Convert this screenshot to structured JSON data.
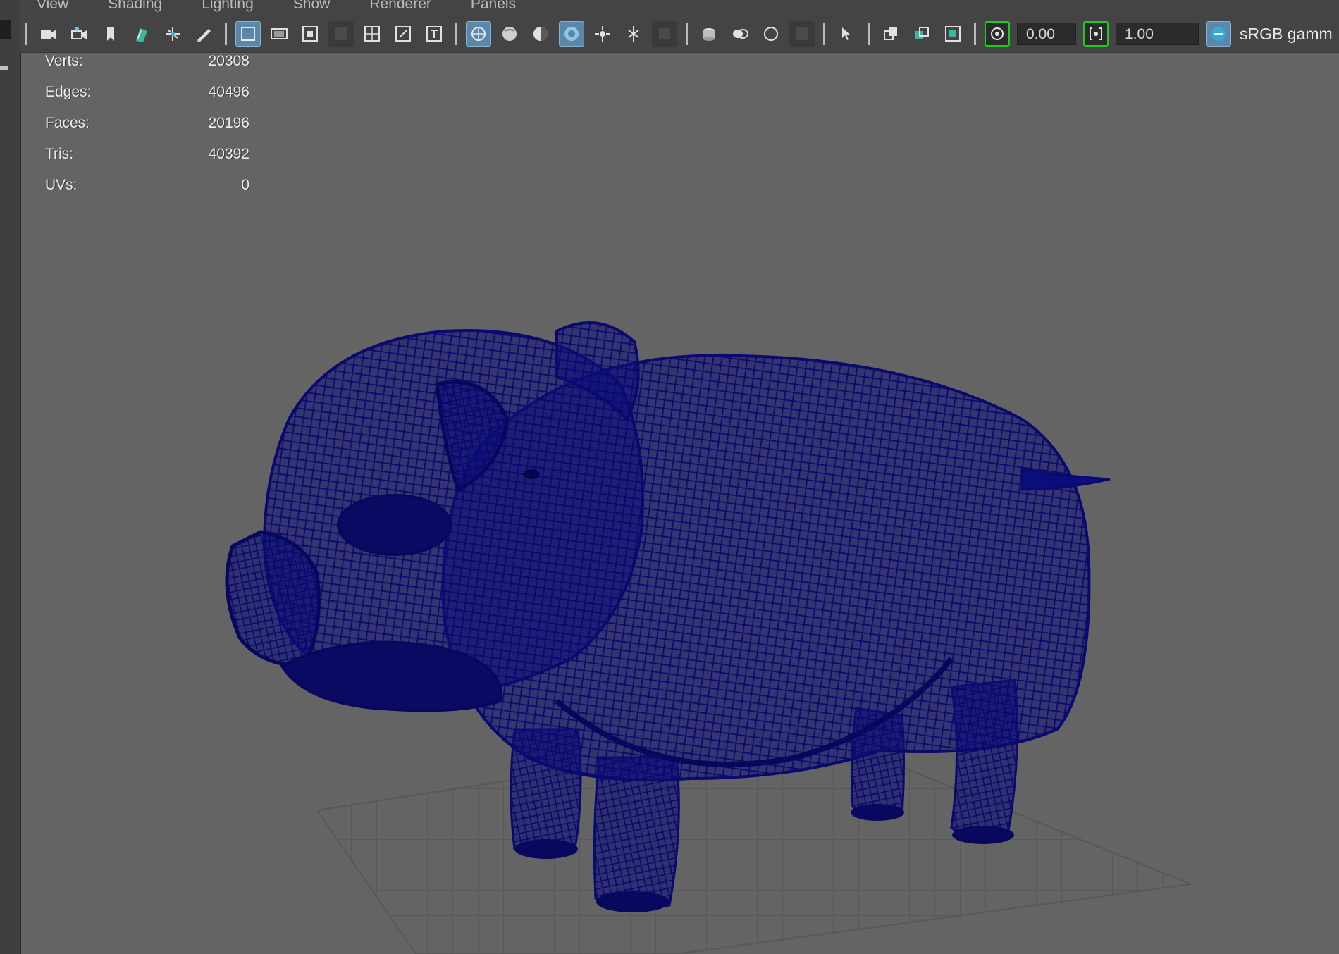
{
  "menu": {
    "items": [
      {
        "label": "View"
      },
      {
        "label": "Shading"
      },
      {
        "label": "Lighting"
      },
      {
        "label": "Show"
      },
      {
        "label": "Renderer"
      },
      {
        "label": "Panels"
      }
    ]
  },
  "toolbar": {
    "icons": [
      "camera-icon",
      "camera-attributes-icon",
      "bookmark-icon",
      "image-plane-icon",
      "grid-toggle-icon",
      "grease-pencil-icon",
      "wireframe-shading-icon",
      "film-gate-icon",
      "resolution-gate-icon",
      "gate-mask-icon",
      "field-chart-icon",
      "safe-action-icon",
      "safe-title-icon",
      "wireframe-on-shaded-icon",
      "smooth-shade-icon",
      "use-default-material-icon",
      "xray-icon",
      "lights-icon",
      "shadows-icon",
      "ambient-occlusion-icon",
      "motion-blur-icon",
      "multisample-aa-icon",
      "depth-of-field-icon",
      "isolate-select-icon",
      "xray-joints-icon",
      "xray-active-components-icon",
      "camera-exposure-icon",
      "camera-gamma-icon",
      "color-management-icon"
    ],
    "exposure_value": "0.00",
    "gamma_value": "1.00",
    "color_space_label": "sRGB gamm"
  },
  "hud": {
    "rows": [
      {
        "label": "Verts:",
        "value": "20308"
      },
      {
        "label": "Edges:",
        "value": "40496"
      },
      {
        "label": "Faces:",
        "value": "20196"
      },
      {
        "label": "Tris:",
        "value": "40392"
      },
      {
        "label": "UVs:",
        "value": "0"
      }
    ]
  },
  "scene": {
    "model_name": "pig-mesh",
    "wire_color": "#0c0c7a",
    "grid_color": "#4e4e4e",
    "background_color": "#646464"
  }
}
